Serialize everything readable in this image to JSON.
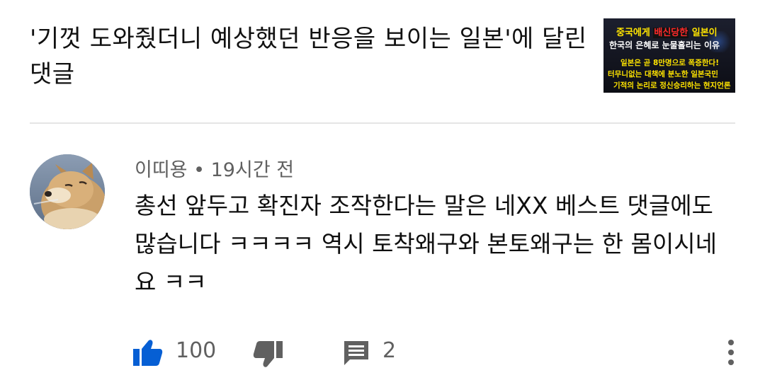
{
  "video": {
    "title": "'기껏 도와줬더니 예상했던 반응을 보이는 일본'에 달린 댓글",
    "thumbnail": {
      "line1_pre": "중국에게 ",
      "line1_highlight": "배신당한",
      "line1_post": " 일본이",
      "line2": "한국의 은혜로 눈물흘리는 이유",
      "line3": "일본은 곧 8만명으로 폭증한다!",
      "line4": "터무니없는 대책에 분노한 일본국민",
      "line5": "기적의 논리로 정신승리하는 현지언론"
    }
  },
  "comment": {
    "author": "이띠용",
    "separator": " • ",
    "time": "19시간 전",
    "text": "총선 앞두고 확진자 조작한다는 말은 네XX 베스트 댓글에도 많습니다 ㅋㅋㅋㅋ 역시 토착왜구와 본토왜구는 한 몸이시네요 ㅋㅋ",
    "like_count": "100",
    "reply_count": "2",
    "liked": true
  },
  "colors": {
    "like_active": "#065fd4",
    "icon_gray": "#606060",
    "divider": "#e5e5e5"
  },
  "icons": {
    "like": "thumbs-up-icon",
    "dislike": "thumbs-down-icon",
    "reply": "comment-icon",
    "more": "more-vert-icon"
  }
}
